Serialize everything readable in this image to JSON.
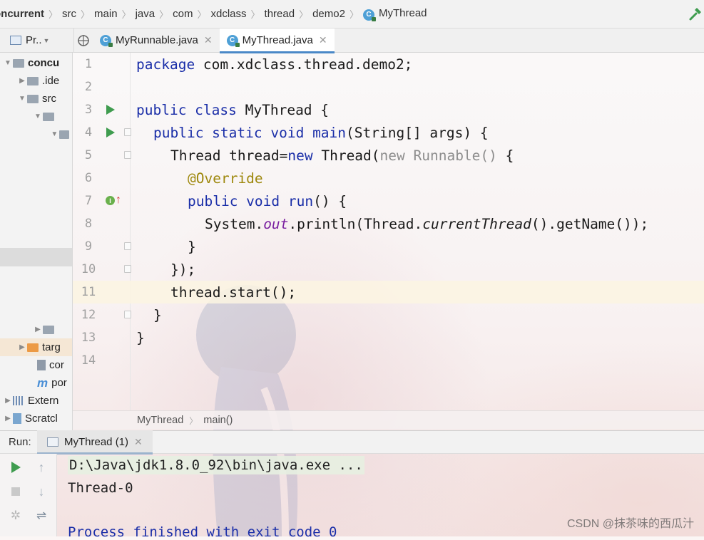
{
  "breadcrumb": {
    "items": [
      "oncurrent",
      "src",
      "main",
      "java",
      "com",
      "xdclass",
      "thread",
      "demo2"
    ],
    "current": "MyThread",
    "class_icon": "C"
  },
  "tabs": {
    "project_label": "Pr..",
    "editor_tabs": [
      {
        "label": "MyRunnable.java",
        "active": false
      },
      {
        "label": "MyThread.java",
        "active": true
      }
    ]
  },
  "project_tree": {
    "items": [
      {
        "label": "concu"
      },
      {
        "label": ".ide"
      },
      {
        "label": "src"
      },
      {
        "label": ""
      },
      {
        "label": ""
      },
      {
        "label": ""
      },
      {
        "label": "targ"
      },
      {
        "label": "cor"
      },
      {
        "label": "por"
      },
      {
        "label": "Extern"
      },
      {
        "label": "Scratcl"
      }
    ]
  },
  "editor": {
    "line_numbers": [
      "1",
      "2",
      "3",
      "4",
      "5",
      "6",
      "7",
      "8",
      "9",
      "10",
      "11",
      "12",
      "13",
      "14"
    ],
    "lines": {
      "l1_kw": "package",
      "l1_rest": " com.xdclass.thread.demo2;",
      "l3_kw": "public class",
      "l3_rest": " MyThread {",
      "l4_kw": "public static void",
      "l4_name": " main",
      "l4_rest": "(String[] args) {",
      "l5_a": "Thread thread=",
      "l5_kw": "new",
      "l5_b": " Thread(",
      "l5_gray": "new Runnable()",
      "l5_c": " {",
      "l6_ann": "@Override",
      "l7_kw": "public void",
      "l7_name": " run",
      "l7_rest": "() {",
      "l8_a": "System.",
      "l8_field": "out",
      "l8_b": ".println(Thread.",
      "l8_italic": "currentThread",
      "l8_c": "().getName());",
      "l9": "}",
      "l10": "});",
      "l11": "thread.start();",
      "l12": "}",
      "l13": "}"
    },
    "footer": {
      "class": "MyThread",
      "method": "main()"
    }
  },
  "run": {
    "label": "Run:",
    "tab_label": "MyThread (1)",
    "console": {
      "cmd": "D:\\Java\\jdk1.8.0_92\\bin\\java.exe ...",
      "output": "Thread-0",
      "process": "Process finished with exit code 0"
    }
  },
  "watermark": "CSDN @抹茶味的西瓜汁"
}
